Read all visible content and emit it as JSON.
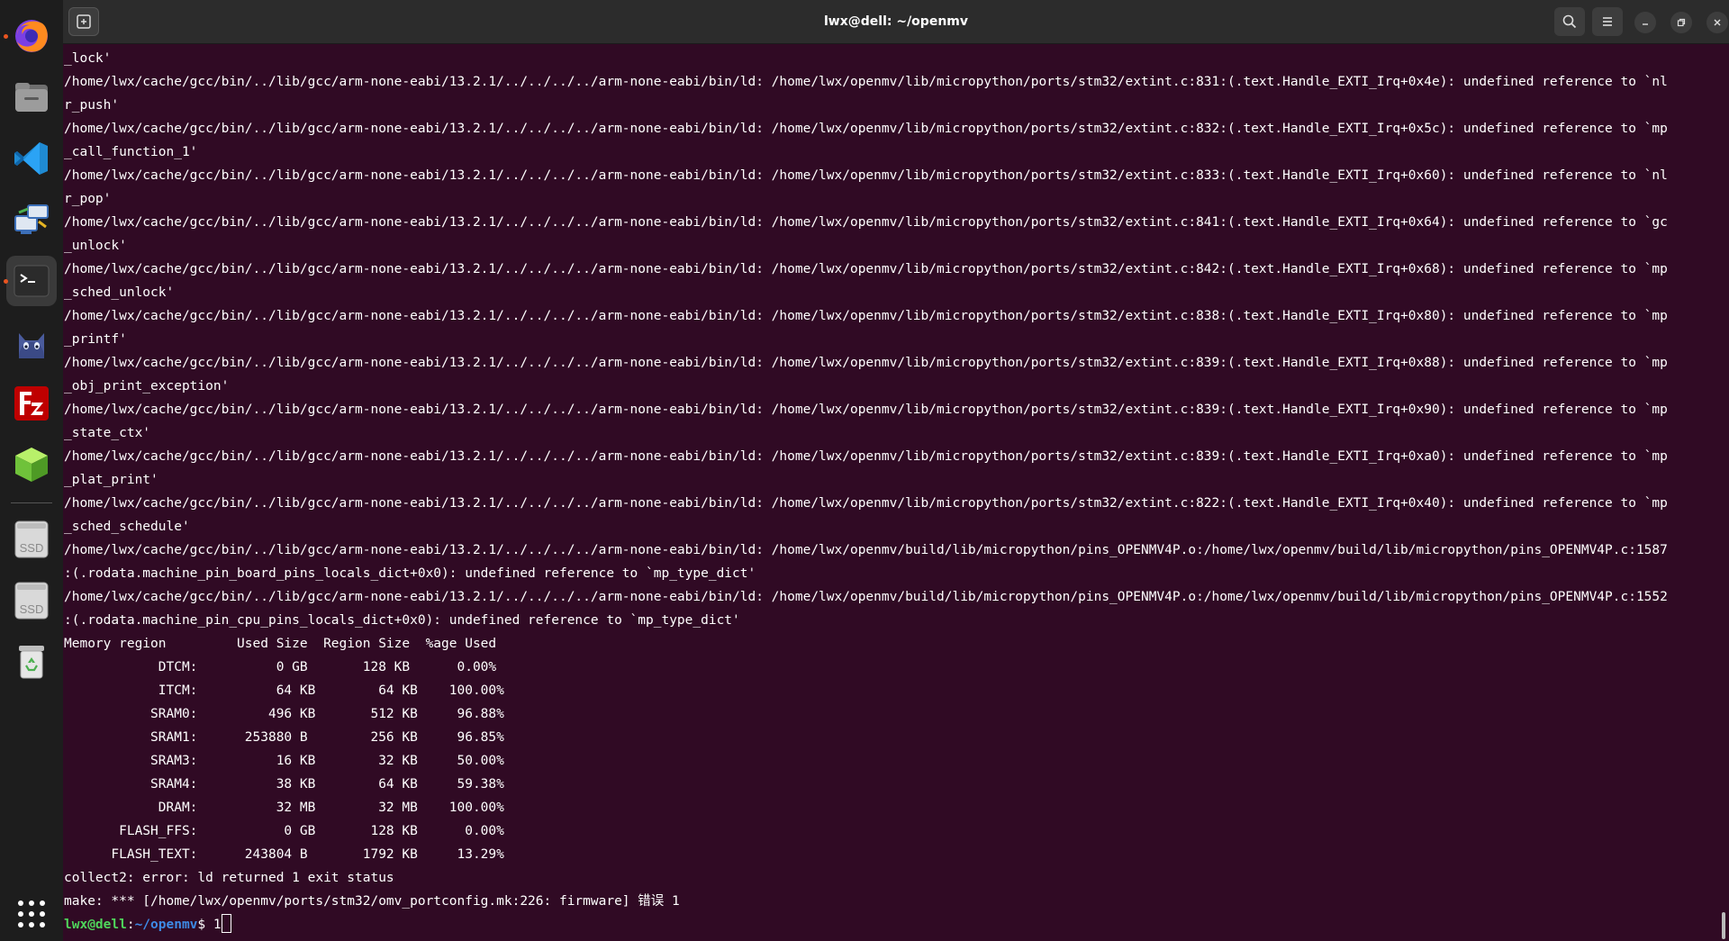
{
  "window": {
    "title": "lwx@dell: ~/openmv"
  },
  "dock": {
    "apps": [
      {
        "name": "firefox-icon",
        "running": true
      },
      {
        "name": "files-icon",
        "running": false
      },
      {
        "name": "vscode-icon",
        "running": false
      },
      {
        "name": "remote-desktop-icon",
        "running": false
      },
      {
        "name": "terminal-icon",
        "running": true,
        "active": true
      },
      {
        "name": "cat-app-icon",
        "running": false
      },
      {
        "name": "filezilla-icon",
        "running": false
      },
      {
        "name": "3d-cube-app-icon",
        "running": false
      }
    ],
    "drives": [
      {
        "label": "SSD"
      },
      {
        "label": "SSD"
      }
    ]
  },
  "terminal": {
    "lines": [
      "_lock'",
      "/home/lwx/cache/gcc/bin/../lib/gcc/arm-none-eabi/13.2.1/../../../../arm-none-eabi/bin/ld: /home/lwx/openmv/lib/micropython/ports/stm32/extint.c:831:(.text.Handle_EXTI_Irq+0x4e): undefined reference to `nl",
      "r_push'",
      "/home/lwx/cache/gcc/bin/../lib/gcc/arm-none-eabi/13.2.1/../../../../arm-none-eabi/bin/ld: /home/lwx/openmv/lib/micropython/ports/stm32/extint.c:832:(.text.Handle_EXTI_Irq+0x5c): undefined reference to `mp",
      "_call_function_1'",
      "/home/lwx/cache/gcc/bin/../lib/gcc/arm-none-eabi/13.2.1/../../../../arm-none-eabi/bin/ld: /home/lwx/openmv/lib/micropython/ports/stm32/extint.c:833:(.text.Handle_EXTI_Irq+0x60): undefined reference to `nl",
      "r_pop'",
      "/home/lwx/cache/gcc/bin/../lib/gcc/arm-none-eabi/13.2.1/../../../../arm-none-eabi/bin/ld: /home/lwx/openmv/lib/micropython/ports/stm32/extint.c:841:(.text.Handle_EXTI_Irq+0x64): undefined reference to `gc",
      "_unlock'",
      "/home/lwx/cache/gcc/bin/../lib/gcc/arm-none-eabi/13.2.1/../../../../arm-none-eabi/bin/ld: /home/lwx/openmv/lib/micropython/ports/stm32/extint.c:842:(.text.Handle_EXTI_Irq+0x68): undefined reference to `mp",
      "_sched_unlock'",
      "/home/lwx/cache/gcc/bin/../lib/gcc/arm-none-eabi/13.2.1/../../../../arm-none-eabi/bin/ld: /home/lwx/openmv/lib/micropython/ports/stm32/extint.c:838:(.text.Handle_EXTI_Irq+0x80): undefined reference to `mp",
      "_printf'",
      "/home/lwx/cache/gcc/bin/../lib/gcc/arm-none-eabi/13.2.1/../../../../arm-none-eabi/bin/ld: /home/lwx/openmv/lib/micropython/ports/stm32/extint.c:839:(.text.Handle_EXTI_Irq+0x88): undefined reference to `mp",
      "_obj_print_exception'",
      "/home/lwx/cache/gcc/bin/../lib/gcc/arm-none-eabi/13.2.1/../../../../arm-none-eabi/bin/ld: /home/lwx/openmv/lib/micropython/ports/stm32/extint.c:839:(.text.Handle_EXTI_Irq+0x90): undefined reference to `mp",
      "_state_ctx'",
      "/home/lwx/cache/gcc/bin/../lib/gcc/arm-none-eabi/13.2.1/../../../../arm-none-eabi/bin/ld: /home/lwx/openmv/lib/micropython/ports/stm32/extint.c:839:(.text.Handle_EXTI_Irq+0xa0): undefined reference to `mp",
      "_plat_print'",
      "/home/lwx/cache/gcc/bin/../lib/gcc/arm-none-eabi/13.2.1/../../../../arm-none-eabi/bin/ld: /home/lwx/openmv/lib/micropython/ports/stm32/extint.c:822:(.text.Handle_EXTI_Irq+0x40): undefined reference to `mp",
      "_sched_schedule'",
      "/home/lwx/cache/gcc/bin/../lib/gcc/arm-none-eabi/13.2.1/../../../../arm-none-eabi/bin/ld: /home/lwx/openmv/build/lib/micropython/pins_OPENMV4P.o:/home/lwx/openmv/build/lib/micropython/pins_OPENMV4P.c:1587",
      ":(.rodata.machine_pin_board_pins_locals_dict+0x0): undefined reference to `mp_type_dict'",
      "/home/lwx/cache/gcc/bin/../lib/gcc/arm-none-eabi/13.2.1/../../../../arm-none-eabi/bin/ld: /home/lwx/openmv/build/lib/micropython/pins_OPENMV4P.o:/home/lwx/openmv/build/lib/micropython/pins_OPENMV4P.c:1552",
      ":(.rodata.machine_pin_cpu_pins_locals_dict+0x0): undefined reference to `mp_type_dict'",
      "Memory region         Used Size  Region Size  %age Used",
      "            DTCM:          0 GB       128 KB      0.00%",
      "            ITCM:          64 KB        64 KB    100.00%",
      "           SRAM0:         496 KB       512 KB     96.88%",
      "           SRAM1:      253880 B        256 KB     96.85%",
      "           SRAM3:          16 KB        32 KB     50.00%",
      "           SRAM4:          38 KB        64 KB     59.38%",
      "            DRAM:          32 MB        32 MB    100.00%",
      "       FLASH_FFS:           0 GB       128 KB      0.00%",
      "      FLASH_TEXT:      243804 B       1792 KB     13.29%",
      "collect2: error: ld returned 1 exit status",
      "make: *** [/home/lwx/openmv/ports/stm32/omv_portconfig.mk:226: firmware] 错误 1"
    ],
    "prompt": {
      "user_host": "lwx@dell",
      "colon": ":",
      "path": "~/openmv",
      "symbol": "$ ",
      "input": "1"
    }
  }
}
